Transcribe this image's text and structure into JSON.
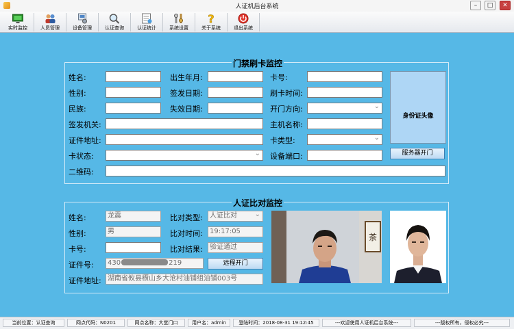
{
  "window": {
    "title": "人证机后台系统",
    "minimize": "–",
    "maximize": "□",
    "close": "✕"
  },
  "toolbar": [
    {
      "label": "实时监控",
      "icon": "monitor-icon"
    },
    {
      "label": "人员管理",
      "icon": "users-icon"
    },
    {
      "label": "设备管理",
      "icon": "device-icon"
    },
    {
      "label": "认证查询",
      "icon": "search-icon"
    },
    {
      "label": "认证统计",
      "icon": "statistics-icon"
    },
    {
      "label": "系统设置",
      "icon": "settings-icon"
    },
    {
      "label": "关于系统",
      "icon": "help-icon"
    },
    {
      "label": "退出系统",
      "icon": "power-icon"
    }
  ],
  "access_monitor": {
    "title": "门禁刷卡监控",
    "labels": {
      "name": "姓名:",
      "birth": "出生年月:",
      "card_no": "卡号:",
      "gender": "性别:",
      "issue_date": "签发日期:",
      "swipe_time": "刷卡时间:",
      "ethnicity": "民族:",
      "expiry_date": "失效日期:",
      "door_direction": "开门方向:",
      "issuer": "签发机关:",
      "host_name": "主机名称:",
      "address": "证件地址:",
      "card_type": "卡类型:",
      "card_status": "卡状态:",
      "device_port": "设备端口:",
      "qrcode": "二维码:"
    },
    "photo_caption": "身份证头像",
    "server_open_button": "服务器开门"
  },
  "compare_monitor": {
    "title": "人证比对监控",
    "labels": {
      "name": "姓名:",
      "compare_type": "比对类型:",
      "gender": "性别:",
      "compare_time": "比对时间:",
      "card_no": "卡号:",
      "compare_result": "比对结果:",
      "id_no": "证件号:",
      "address": "证件地址:"
    },
    "values": {
      "name": "龙震",
      "compare_type": "人证比对",
      "gender": "男",
      "compare_time": "19:17:05",
      "card_no": "",
      "compare_result": "验证通过",
      "id_no_prefix": "430",
      "id_no_suffix": "219",
      "address": "湖南省攸县槚山乡大沧村油铺组油铺003号"
    },
    "remote_open_button": "远程开门"
  },
  "statusbar": {
    "location": "当前位置：认证查询",
    "site_code": "网点代码：N0201",
    "site_name": "网点名称：大堂门口",
    "user": "用户名：admin",
    "login_time": "登陆时间：2018-08-31 19:12:45",
    "welcome": "---欢迎使用人证机后台系统---",
    "copyright": "---版权所有，侵权必究---"
  }
}
